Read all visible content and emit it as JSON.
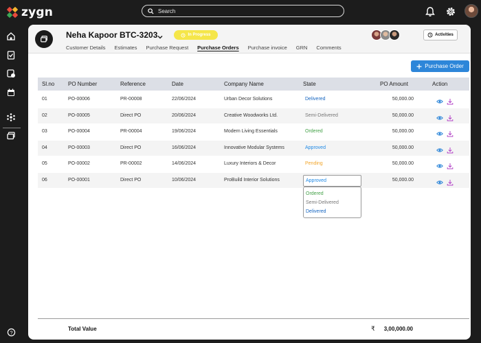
{
  "app": {
    "name": "zygn"
  },
  "search": {
    "placeholder": "Search"
  },
  "colors": {
    "accent": "#2d86d9",
    "status_pill": "#f5e64a",
    "delivered": "#1565c0",
    "semi_delivered": "#777777",
    "ordered": "#43a047",
    "approved": "#1e88e5",
    "pending": "#f2a52a",
    "action_view": "#2d86d9",
    "action_download": "#b345c7"
  },
  "icons": {
    "top": [
      "bell-icon",
      "gear-icon"
    ],
    "sidebar": [
      "home-icon",
      "clipboard-icon",
      "settings-doc-icon",
      "calendar-icon",
      "network-icon",
      "folders-icon",
      "help-icon"
    ],
    "actions": [
      "eye-icon",
      "download-icon"
    ]
  },
  "project": {
    "title": "Neha Kapoor BTC-3203",
    "status": "In Progress",
    "activities_label": "Activities",
    "tabs": [
      "Customer Details",
      "Estimates",
      "Purchase Request",
      "Purchase Orders",
      "Purchase invoice",
      "GRN",
      "Comments"
    ],
    "active_tab": "Purchase Orders"
  },
  "purchase_order_button": "Purchase Order",
  "table": {
    "columns": [
      "Sl.no",
      "PO Number",
      "Reference",
      "Date",
      "Company Name",
      "State",
      "PO Amount",
      "Action"
    ],
    "rows": [
      {
        "slno": "01",
        "po": "PO-00006",
        "ref": "PR-00008",
        "date": "22/06/2024",
        "company": "Urban Decor Solutions",
        "state": "Delivered",
        "amount": "50,000.00"
      },
      {
        "slno": "02",
        "po": "PO-00005",
        "ref": "Direct PO",
        "date": "20/06/2024",
        "company": "Creative Woodworks Ltd.",
        "state": "Semi-Delivered",
        "amount": "50,000.00"
      },
      {
        "slno": "03",
        "po": "PO-00004",
        "ref": "PR-00004",
        "date": "19/06/2024",
        "company": "Modern Living Essentials",
        "state": "Ordered",
        "amount": "50,000.00"
      },
      {
        "slno": "04",
        "po": "PO-00003",
        "ref": "Direct PO",
        "date": "16/06/2024",
        "company": "Innovative Modular Systems",
        "state": "Approved",
        "amount": "50,000.00"
      },
      {
        "slno": "05",
        "po": "PO-00002",
        "ref": "PR-00002",
        "date": "14/06/2024",
        "company": "Luxury Interiors & Decor",
        "state": "Pending",
        "amount": "50,000.00"
      },
      {
        "slno": "06",
        "po": "PO-00001",
        "ref": "Direct PO",
        "date": "10/06/2024",
        "company": "ProBuild Interior Solutions",
        "state": "Approved",
        "amount": "50,000.00"
      }
    ]
  },
  "state_dropdown": {
    "selected": "Approved",
    "options": [
      "Ordered",
      "Semi-Delivered",
      "Delivered"
    ]
  },
  "total": {
    "label": "Total Value",
    "currency": "₹",
    "value": "3,00,000.00"
  }
}
